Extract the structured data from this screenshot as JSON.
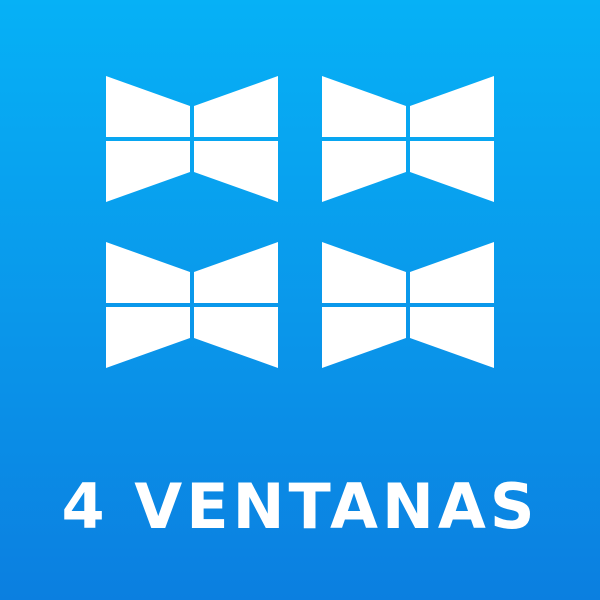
{
  "caption": "4 VENTANAS",
  "icons": [
    "windows-logo-icon",
    "windows-logo-icon",
    "windows-logo-icon",
    "windows-logo-icon"
  ],
  "colors": {
    "background_top": "#06b1f6",
    "background_bottom": "#0b7fe0",
    "foreground": "#ffffff"
  }
}
